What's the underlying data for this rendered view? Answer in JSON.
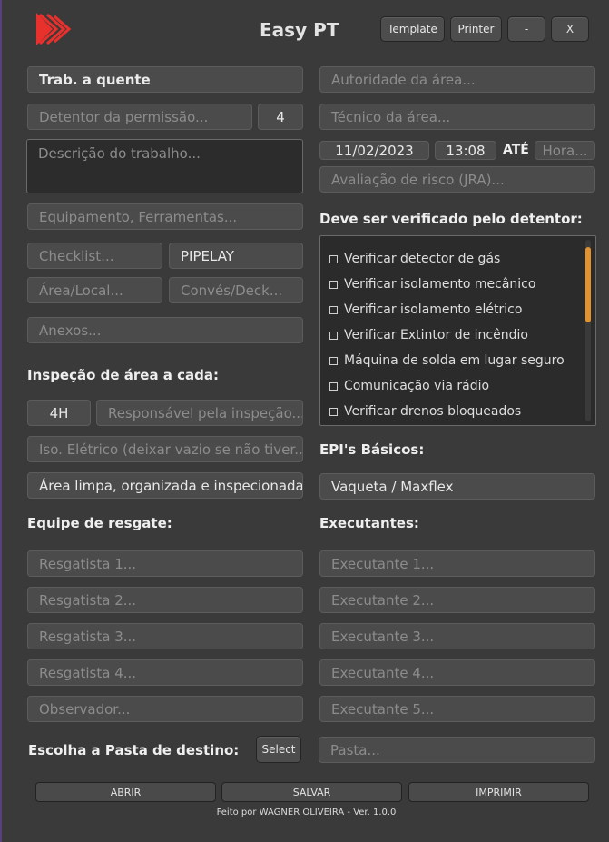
{
  "header": {
    "title": "Easy PT",
    "template_label": "Template",
    "printer_label": "Printer",
    "minimize_label": "-",
    "close_label": "X",
    "logo_icon": "play-chevrons-icon",
    "logo_color": "#e8302c"
  },
  "left": {
    "permit_type": "Trab. a quente",
    "holder_placeholder": "Detentor da permissão...",
    "holder_count": "4",
    "description_placeholder": "Descrição do trabalho...",
    "equipment_placeholder": "Equipamento, Ferramentas...",
    "checklist_placeholder": "Checklist...",
    "project_value": "PIPELAY",
    "area_placeholder": "Área/Local...",
    "deck_placeholder": "Convés/Deck...",
    "attachments_placeholder": "Anexos...",
    "inspection_label": "Inspeção de área a cada:",
    "inspection_interval": "4H",
    "inspector_placeholder": "Responsável pela inspeção...",
    "electrical_iso_placeholder": "Iso. Elétrico (deixar vazio se não tiver...)",
    "area_status_value": "Área limpa, organizada e inspecionada",
    "rescue_label": "Equipe de resgate:",
    "rescuers": [
      "Resgatista 1...",
      "Resgatista 2...",
      "Resgatista 3...",
      "Resgatista 4...",
      "Observador..."
    ],
    "folder_label": "Escolha a Pasta de destino:",
    "select_label": "Select"
  },
  "right": {
    "authority_placeholder": "Autoridade da área...",
    "technician_placeholder": "Técnico da área...",
    "date_value": "11/02/2023",
    "time_value": "13:08",
    "until_label": "ATÉ",
    "end_time_placeholder": "Hora...",
    "risk_placeholder": "Avaliação de risco (JRA)...",
    "verify_label": "Deve ser verificado pelo detentor:",
    "checks": [
      "Verificar detector de gás",
      "Verificar isolamento mecânico",
      "Verificar isolamento elétrico",
      "Verificar Extintor de incêndio",
      "Máquina de solda em lugar seguro",
      "Comunicação via rádio",
      "Verificar drenos bloqueados"
    ],
    "epi_label": "EPI's Básicos:",
    "epi_value": "Vaqueta / Maxflex",
    "executors_label": "Executantes:",
    "executors": [
      "Executante 1...",
      "Executante 2...",
      "Executante 3...",
      "Executante 4...",
      "Executante 5..."
    ],
    "folder_placeholder": "Pasta..."
  },
  "footer": {
    "open_label": "ABRIR",
    "save_label": "SALVAR",
    "print_label": "IMPRIMIR",
    "credit": "Feito por WAGNER OLIVEIRA - Ver. 1.0.0"
  }
}
